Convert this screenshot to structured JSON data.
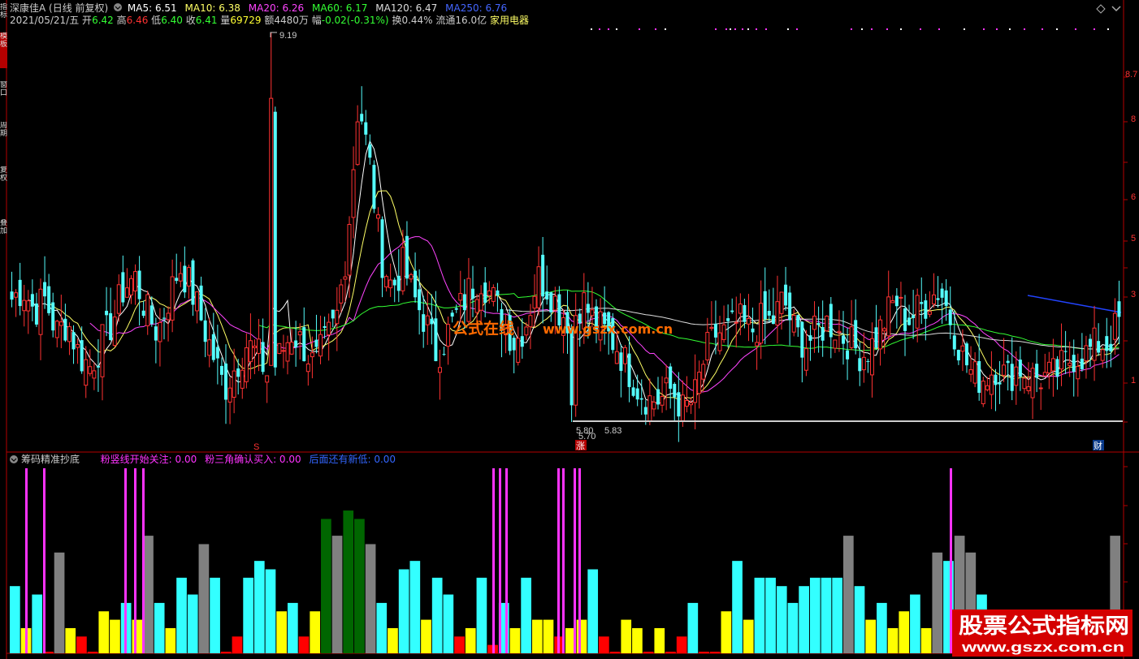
{
  "stock": {
    "name": "深康佳A",
    "mode": "(日线 前复权)",
    "date": "2021/05/21/五",
    "open_label": "开",
    "open": "6.42",
    "high_label": "高",
    "high": "6.46",
    "low_label": "低",
    "low": "6.40",
    "close_label": "收",
    "close": "6.41",
    "vol_label": "量",
    "vol": "69729",
    "amount_label": "额",
    "amount": "4480万",
    "change_label": "幅",
    "change": "-0.02(-0.31%)",
    "turnover_label": "换",
    "turnover": "0.44%",
    "float_label": "流通",
    "float": "16.0亿",
    "industry": "家用电器"
  },
  "ma_labels": [
    {
      "text": "MA5: 6.51",
      "color": "#ffffff"
    },
    {
      "text": "MA10: 6.38",
      "color": "#ffff66"
    },
    {
      "text": "MA20: 6.26",
      "color": "#ff44ff"
    },
    {
      "text": "MA60: 6.17",
      "color": "#33ff33"
    },
    {
      "text": "MA120: 6.47",
      "color": "#dddddd"
    },
    {
      "text": "MA250: 6.76",
      "color": "#4466ff"
    }
  ],
  "price_marks": {
    "high": "9.19",
    "low": "5.70",
    "low_a": "5.80",
    "low_b": "5.83"
  },
  "price_axis": [
    "8.7",
    "8",
    "6",
    "5",
    "3",
    "1"
  ],
  "event_marks": {
    "s": "S",
    "zhang": "涨",
    "cai": "财"
  },
  "indicator": {
    "title": "筹码精准抄底",
    "label1": "粉竖线开始关注: 0.00",
    "label2": "粉三角确认买入: 0.00",
    "label3": "后面还有新低: 0.00"
  },
  "side_tabs": [
    "指标",
    "模板",
    "窗口",
    "周期",
    "复权",
    "叠加"
  ],
  "watermark": {
    "site": "公式在线",
    "url": "www.gszx.com.cn"
  },
  "badge": {
    "line1": "股票公式指标网",
    "line2": "www.gszx.com.cn"
  },
  "colors": {
    "up": "#ff3232",
    "down": "#54fcfc",
    "border": "#b40000",
    "pink": "#ff33ff",
    "green": "#006600",
    "gray": "#808080",
    "cyan": "#33ffff",
    "yellow": "#ffff00",
    "red": "#ff0000"
  },
  "chart_data": {
    "type": "bar",
    "price_range": [
      5.7,
      9.19
    ],
    "close_pattern": [
      6.8,
      6.9,
      6.7,
      6.8,
      6.5,
      6.6,
      6.3,
      6.2,
      6.4,
      6.6,
      6.9,
      7.0,
      6.7,
      6.5,
      6.8,
      7.1,
      6.9,
      6.6,
      6.3,
      6.0,
      6.2,
      6.4,
      6.3,
      6.1,
      6.3,
      6.5,
      6.4,
      6.2,
      6.4,
      6.6,
      7.3,
      8.6,
      8.0,
      7.2,
      6.9,
      7.1,
      6.8,
      6.6,
      6.3,
      6.5,
      6.7,
      6.9,
      7.0,
      6.8,
      6.6,
      6.4,
      6.6,
      7.0,
      6.9,
      6.7,
      6.6,
      6.8,
      6.6,
      6.5,
      6.4,
      6.2,
      6.0,
      5.9,
      5.9,
      6.0,
      5.8,
      5.9,
      6.3,
      6.5,
      6.5,
      6.6,
      6.5,
      6.6,
      6.6,
      6.8,
      6.5,
      6.4,
      6.5,
      6.6,
      6.5,
      6.4,
      6.3,
      6.4,
      6.6,
      6.8,
      6.6,
      6.7,
      6.8,
      6.9,
      6.6,
      6.3,
      6.1,
      6.1,
      6.2,
      6.1,
      6.2,
      6.1,
      6.1,
      6.1,
      6.2,
      6.3,
      6.3,
      6.4,
      6.4,
      6.6
    ],
    "indicator_bars": [
      8,
      3,
      7,
      0,
      12,
      3,
      2,
      0,
      5,
      4,
      6,
      4,
      14,
      6,
      3,
      9,
      7,
      13,
      9,
      0,
      2,
      9,
      11,
      10,
      5,
      6,
      2,
      5,
      16,
      14,
      17,
      16,
      13,
      6,
      3,
      10,
      11,
      4,
      9,
      7,
      2,
      3,
      9,
      1,
      6,
      3,
      9,
      4,
      4,
      2,
      3,
      4,
      10,
      2,
      0,
      4,
      3,
      0,
      3,
      0,
      2,
      6,
      0,
      0,
      5,
      11,
      4,
      9,
      9,
      8,
      6,
      8,
      9,
      9,
      9,
      14,
      8,
      4,
      6,
      3,
      5,
      7,
      3,
      12,
      11,
      14,
      12,
      7,
      2,
      1,
      2,
      3,
      4,
      2,
      0,
      1,
      3,
      5,
      3,
      14
    ]
  }
}
